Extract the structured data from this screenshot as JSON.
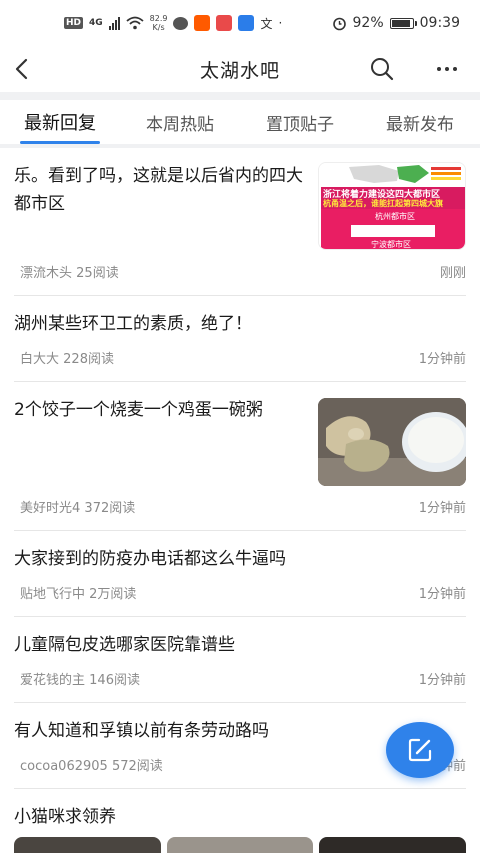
{
  "status_bar": {
    "hd": "HD",
    "network": "4G",
    "speed": "82.9\nK/s",
    "battery": "92%",
    "battery_level": 0.92,
    "time": "09:39"
  },
  "header": {
    "title": "太湖水吧"
  },
  "tabs": [
    {
      "label": "最新回复",
      "active": true
    },
    {
      "label": "本周热贴",
      "active": false
    },
    {
      "label": "置顶贴子",
      "active": false
    },
    {
      "label": "最新发布",
      "active": false
    }
  ],
  "posts": [
    {
      "title": "乐。看到了吗，这就是以后省内的四大都市区",
      "author": "漂流木头",
      "reads": "25阅读",
      "time": "刚刚",
      "has_image": true
    },
    {
      "title": "湖州某些环卫工的素质，绝了！",
      "author": "白大大",
      "reads": "228阅读",
      "time": "1分钟前",
      "has_image": false
    },
    {
      "title": "2个饺子一个烧麦一个鸡蛋一碗粥",
      "author": "美好时光4",
      "reads": "372阅读",
      "time": "1分钟前",
      "has_image": true
    },
    {
      "title": "大家接到的防疫办电话都这么牛逼吗",
      "author": "贴地飞行中",
      "reads": "2万阅读",
      "time": "1分钟前",
      "has_image": false
    },
    {
      "title": "儿童隔包皮选哪家医院靠谱些",
      "author": "爱花钱的主",
      "reads": "146阅读",
      "time": "1分钟前",
      "has_image": false
    },
    {
      "title": "有人知道和孚镇以前有条劳动路吗",
      "author": "cocoa062905",
      "reads": "572阅读",
      "time": "1分钟前",
      "has_image": false
    },
    {
      "title": "小猫咪求领养",
      "has_image": true
    }
  ],
  "thumb1": {
    "line1": "浙江将着力建设这四大都市区",
    "line2": "杭甬温之后，谁能扛起第四城大旗",
    "line3": "杭州都市区",
    "line4": "宁波都市区"
  },
  "colors": {
    "accent": "#2f82ea",
    "text_primary": "#1a1a1a",
    "text_secondary": "#8a8a8a",
    "divider": "#f0f1f3"
  },
  "icons": [
    "back-arrow-icon",
    "search-icon",
    "more-icon",
    "compose-icon"
  ]
}
